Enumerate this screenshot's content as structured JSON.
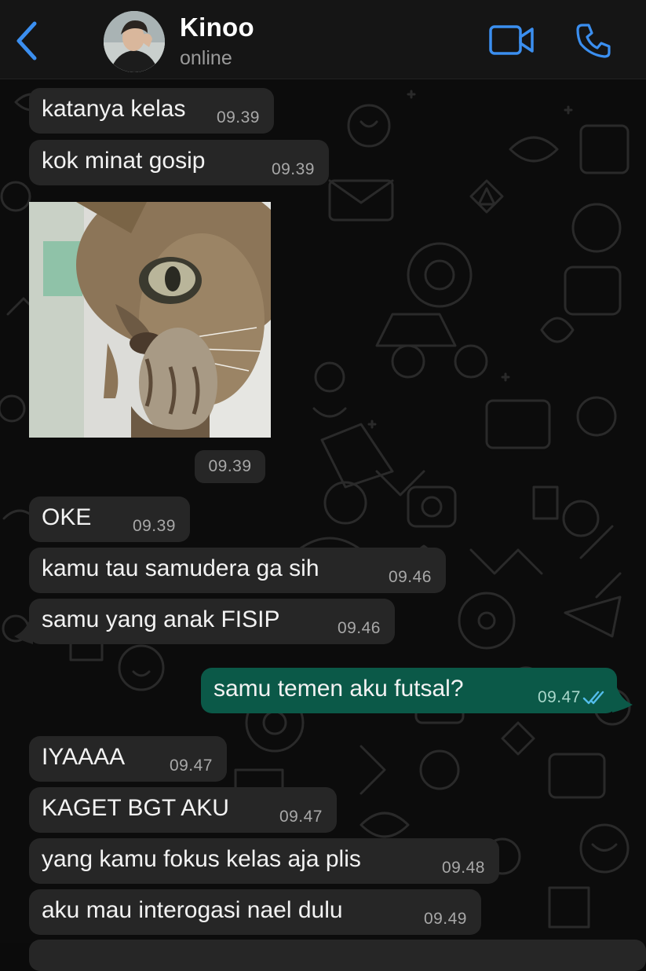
{
  "header": {
    "contact_name": "Kinoo",
    "status": "online",
    "back_icon": "chevron-left-icon",
    "video_icon": "video-camera-icon",
    "call_icon": "phone-icon",
    "accent_color": "#3b8ff0"
  },
  "messages": [
    {
      "type": "text",
      "direction": "incoming",
      "text": "katanya kelas",
      "time": "09.39"
    },
    {
      "type": "text",
      "direction": "incoming",
      "text": "kok minat gosip",
      "time": "09.39"
    },
    {
      "type": "image",
      "direction": "incoming",
      "content": "photo of a kitten",
      "time": "09.39"
    },
    {
      "type": "text",
      "direction": "incoming",
      "text": "OKE",
      "time": "09.39"
    },
    {
      "type": "text",
      "direction": "incoming",
      "text": "kamu tau samudera ga sih",
      "time": "09.46"
    },
    {
      "type": "text",
      "direction": "incoming",
      "text": "samu yang anak FISIP",
      "time": "09.46"
    },
    {
      "type": "text",
      "direction": "outgoing",
      "text": "samu temen aku futsal?",
      "time": "09.47",
      "status": "read"
    },
    {
      "type": "text",
      "direction": "incoming",
      "text": "IYAAAA",
      "time": "09.47"
    },
    {
      "type": "text",
      "direction": "incoming",
      "text": "KAGET BGT AKU",
      "time": "09.47"
    },
    {
      "type": "text",
      "direction": "incoming",
      "text": "yang kamu fokus kelas aja plis",
      "time": "09.48"
    },
    {
      "type": "text",
      "direction": "incoming",
      "text": "aku mau interogasi nael dulu",
      "time": "09.49"
    }
  ],
  "colors": {
    "incoming_bubble": "#262626",
    "outgoing_bubble": "#0b5948",
    "read_ticks": "#53bdeb"
  }
}
